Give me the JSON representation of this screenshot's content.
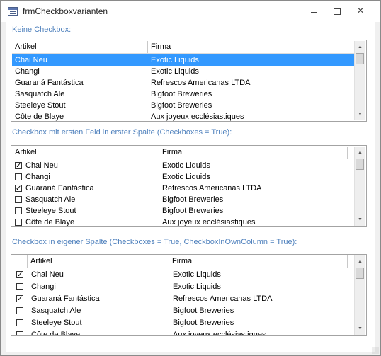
{
  "window": {
    "title": "frmCheckboxvarianten"
  },
  "lists": [
    {
      "label": "Keine Checkbox:",
      "headers": [
        "Artikel",
        "Firma"
      ],
      "rows": [
        {
          "artikel": "Chai Neu",
          "firma": "Exotic Liquids",
          "checked": false,
          "selected": true
        },
        {
          "artikel": "Changi",
          "firma": "Exotic Liquids",
          "checked": false,
          "selected": false
        },
        {
          "artikel": "Guaraná Fantástica",
          "firma": "Refrescos Americanas LTDA",
          "checked": false,
          "selected": false
        },
        {
          "artikel": "Sasquatch Ale",
          "firma": "Bigfoot Breweries",
          "checked": false,
          "selected": false
        },
        {
          "artikel": "Steeleye Stout",
          "firma": "Bigfoot Breweries",
          "checked": false,
          "selected": false
        },
        {
          "artikel": "Côte de Blaye",
          "firma": "Aux joyeux ecclésiastiques",
          "checked": false,
          "selected": false
        }
      ]
    },
    {
      "label": "Checkbox mit ersten Feld in erster Spalte (Checkboxes = True):",
      "headers": [
        "Artikel",
        "Firma"
      ],
      "rows": [
        {
          "artikel": "Chai Neu",
          "firma": "Exotic Liquids",
          "checked": true,
          "selected": false
        },
        {
          "artikel": "Changi",
          "firma": "Exotic Liquids",
          "checked": false,
          "selected": false
        },
        {
          "artikel": "Guaraná Fantástica",
          "firma": "Refrescos Americanas LTDA",
          "checked": true,
          "selected": false
        },
        {
          "artikel": "Sasquatch Ale",
          "firma": "Bigfoot Breweries",
          "checked": false,
          "selected": false
        },
        {
          "artikel": "Steeleye Stout",
          "firma": "Bigfoot Breweries",
          "checked": false,
          "selected": false
        },
        {
          "artikel": "Côte de Blaye",
          "firma": "Aux joyeux ecclésiastiques",
          "checked": false,
          "selected": false
        }
      ]
    },
    {
      "label": "Checkbox in eigener Spalte (Checkboxes = True, CheckboxInOwnColumn = True):",
      "headers": [
        "Artikel",
        "Firma"
      ],
      "rows": [
        {
          "artikel": "Chai Neu",
          "firma": "Exotic Liquids",
          "checked": true,
          "selected": false
        },
        {
          "artikel": "Changi",
          "firma": "Exotic Liquids",
          "checked": false,
          "selected": false
        },
        {
          "artikel": "Guaraná Fantástica",
          "firma": "Refrescos Americanas LTDA",
          "checked": true,
          "selected": false
        },
        {
          "artikel": "Sasquatch Ale",
          "firma": "Bigfoot Breweries",
          "checked": false,
          "selected": false
        },
        {
          "artikel": "Steeleye Stout",
          "firma": "Bigfoot Breweries",
          "checked": false,
          "selected": false
        },
        {
          "artikel": "Côte de Blaye",
          "firma": "Aux joyeux ecclésiastiques",
          "checked": false,
          "selected": false
        }
      ]
    }
  ],
  "colors": {
    "label": "#4f81bd",
    "selection": "#3399ff"
  },
  "icons": [
    "form-icon",
    "minimize-icon",
    "maximize-icon",
    "close-icon",
    "scroll-up-icon",
    "scroll-down-icon",
    "checkmark-icon"
  ]
}
